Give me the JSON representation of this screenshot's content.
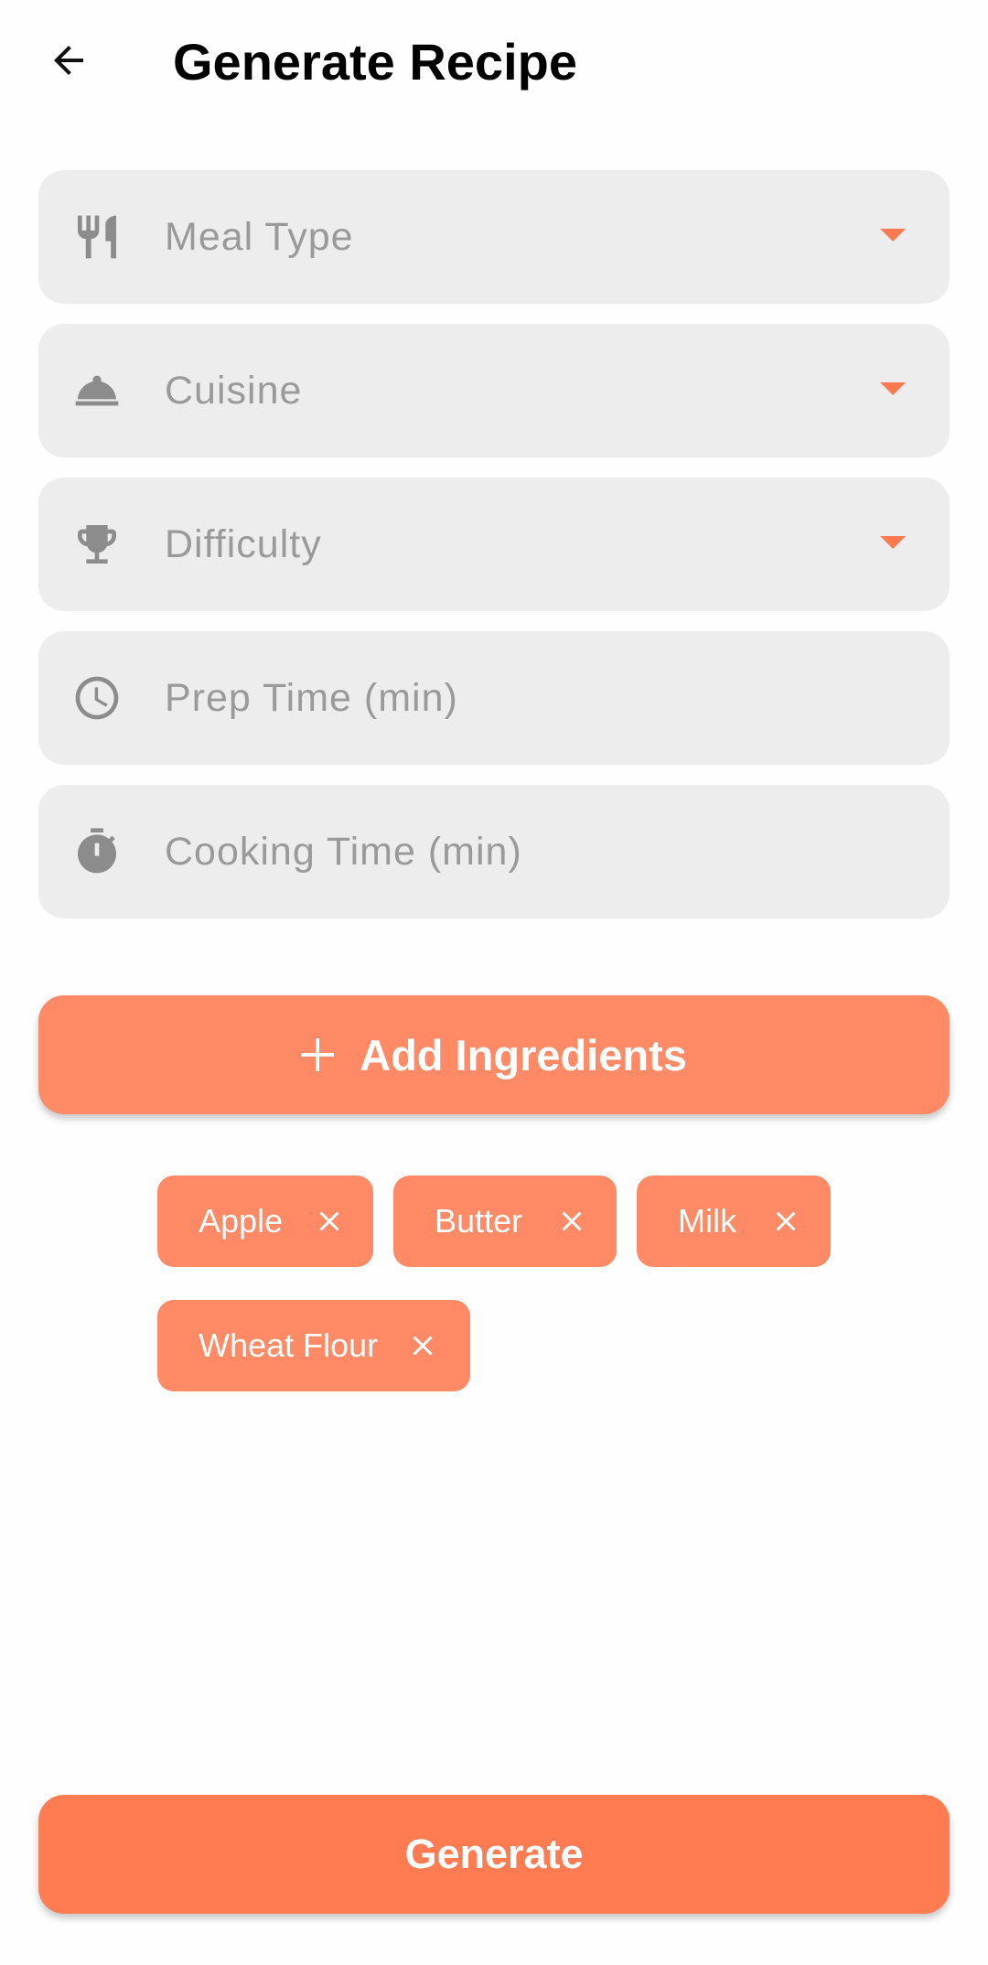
{
  "app_bar": {
    "title": "Generate Recipe",
    "back_icon": "arrow-back-icon"
  },
  "form": {
    "fields": [
      {
        "label": "Meal Type",
        "icon": "fork-knife-icon",
        "type": "dropdown"
      },
      {
        "label": "Cuisine",
        "icon": "cloche-icon",
        "type": "dropdown"
      },
      {
        "label": "Difficulty",
        "icon": "trophy-icon",
        "type": "dropdown"
      },
      {
        "label": "Prep Time (min)",
        "icon": "clock-icon",
        "type": "text"
      },
      {
        "label": "Cooking Time (min)",
        "icon": "timer-icon",
        "type": "text"
      }
    ]
  },
  "ingredients": {
    "add_label": "Add Ingredients",
    "add_icon": "plus-icon",
    "chips": [
      "Apple",
      "Butter",
      "Milk",
      "Wheat Flour"
    ],
    "chip_remove_icon": "close-icon"
  },
  "actions": {
    "generate_label": "Generate"
  },
  "colors": {
    "accent": "#ff8a65",
    "primary_button": "#ff7b51",
    "field_background": "#ededed",
    "placeholder_text": "#9a9a9a",
    "dropdown_caret": "#ff7a50"
  }
}
